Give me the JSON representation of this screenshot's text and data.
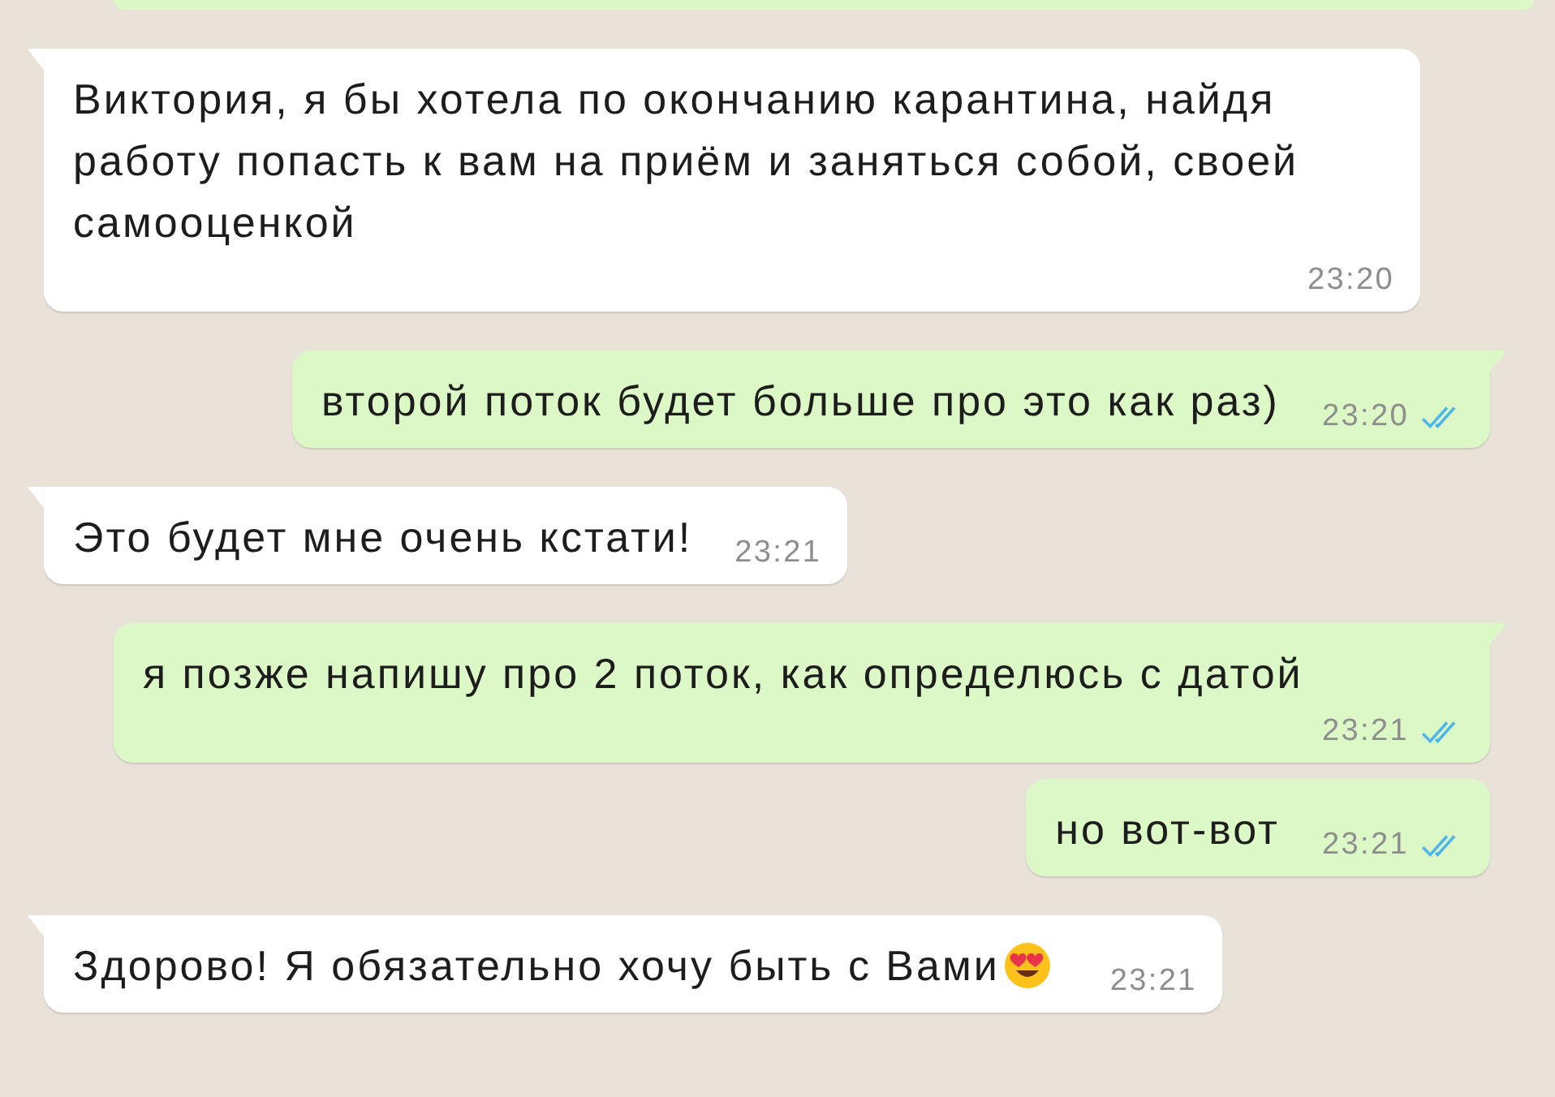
{
  "partial_message": {
    "outgoing": true
  },
  "messages": [
    {
      "outgoing": false,
      "text": "Виктория, я бы хотела по окончанию карантина, найдя работу попасть к вам на приём и заняться собой, своей самооценкой",
      "time": "23:20"
    },
    {
      "outgoing": true,
      "text": "второй поток будет больше про это как раз)",
      "time": "23:20",
      "read": true
    },
    {
      "outgoing": false,
      "text": "Это будет мне очень кстати!",
      "time": "23:21"
    },
    {
      "outgoing": true,
      "text": "я позже напишу про 2 поток, как определюсь с датой",
      "time": "23:21",
      "read": true
    },
    {
      "outgoing": true,
      "text": "но вот-вот",
      "time": "23:21",
      "read": true
    },
    {
      "outgoing": false,
      "text": "Здорово! Я обязательно хочу быть с Вами",
      "time": "23:21",
      "emoji": true
    }
  ]
}
